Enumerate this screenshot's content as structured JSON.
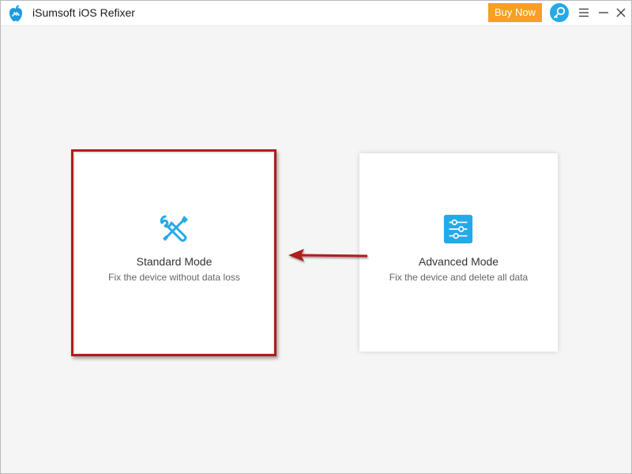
{
  "app": {
    "title": "iSumsoft iOS Refixer",
    "buy_now_label": "Buy Now"
  },
  "window_controls": [
    "key-icon",
    "menu-icon",
    "minimize-icon",
    "close-icon"
  ],
  "modes": [
    {
      "title": "Standard Mode",
      "description": "Fix the device without data loss",
      "icon": "tools-icon",
      "highlighted": true
    },
    {
      "title": "Advanced Mode",
      "description": "Fix the device and delete all data",
      "icon": "sliders-icon",
      "highlighted": false
    }
  ],
  "colors": {
    "accent": "#25a9e8",
    "buy_now": "#f5a121",
    "highlight": "#b11c1c",
    "background": "#f5f5f5"
  }
}
